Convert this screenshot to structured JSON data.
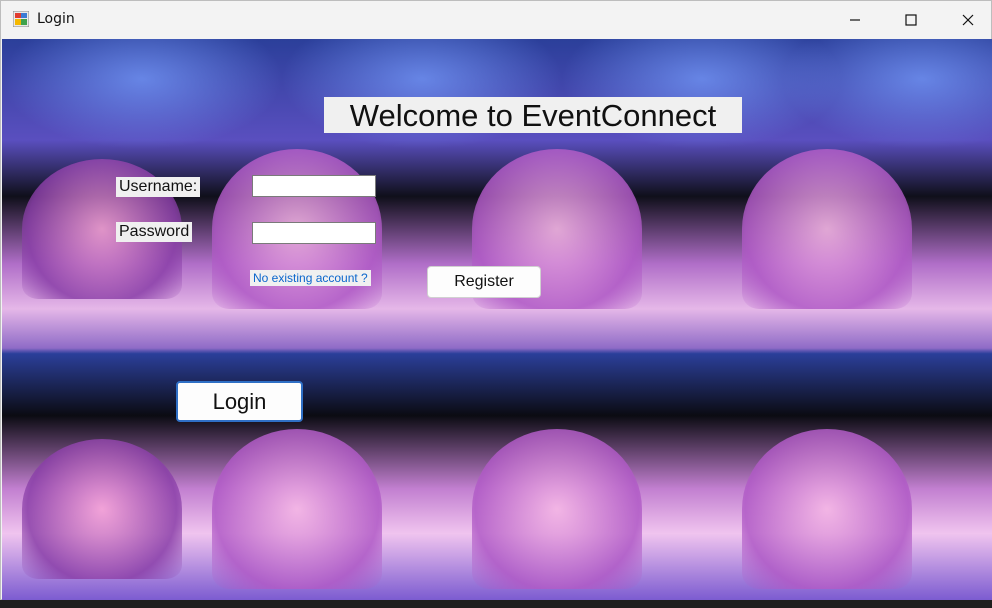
{
  "window": {
    "title": "Login",
    "controls": {
      "minimize": "minimize-icon",
      "maximize": "maximize-icon",
      "close": "close-icon"
    }
  },
  "form": {
    "heading": "Welcome to EventConnect",
    "username_label": "Username:",
    "password_label": "Password",
    "username_value": "",
    "password_value": "",
    "no_account_link": "No existing account ?",
    "register_label": "Register",
    "login_label": "Login"
  },
  "colors": {
    "link": "#0a66cc",
    "login_border": "#2f6fc5",
    "label_bg": "#f0f0f0"
  }
}
